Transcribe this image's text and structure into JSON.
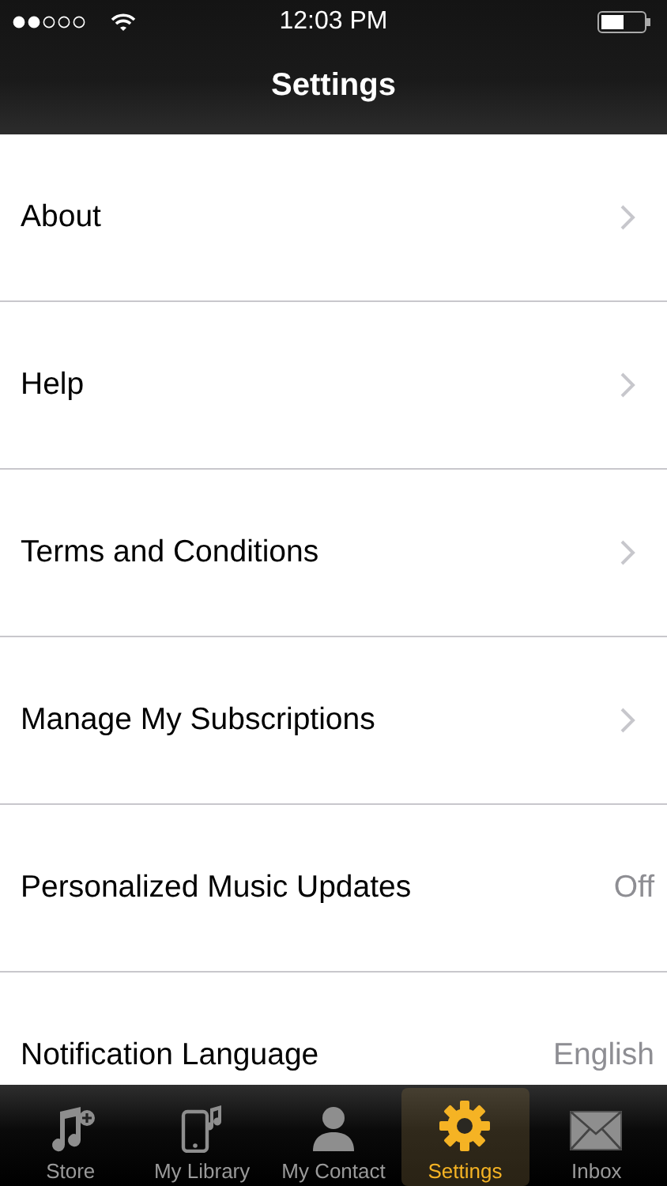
{
  "status_bar": {
    "time": "12:03 PM"
  },
  "nav": {
    "title": "Settings"
  },
  "rows": [
    {
      "kind": "link",
      "label": "About"
    },
    {
      "kind": "link",
      "label": "Help"
    },
    {
      "kind": "link",
      "label": "Terms and Conditions"
    },
    {
      "kind": "link",
      "label": "Manage My Subscriptions"
    },
    {
      "kind": "value",
      "label": "Personalized Music Updates",
      "value": "Off"
    },
    {
      "kind": "value",
      "label": "Notification Language",
      "value": "English"
    }
  ],
  "tabs": [
    {
      "label": "Store",
      "selected": false
    },
    {
      "label": "My Library",
      "selected": false
    },
    {
      "label": "My Contact",
      "selected": false
    },
    {
      "label": "Settings",
      "selected": true
    },
    {
      "label": "Inbox",
      "selected": false
    }
  ]
}
